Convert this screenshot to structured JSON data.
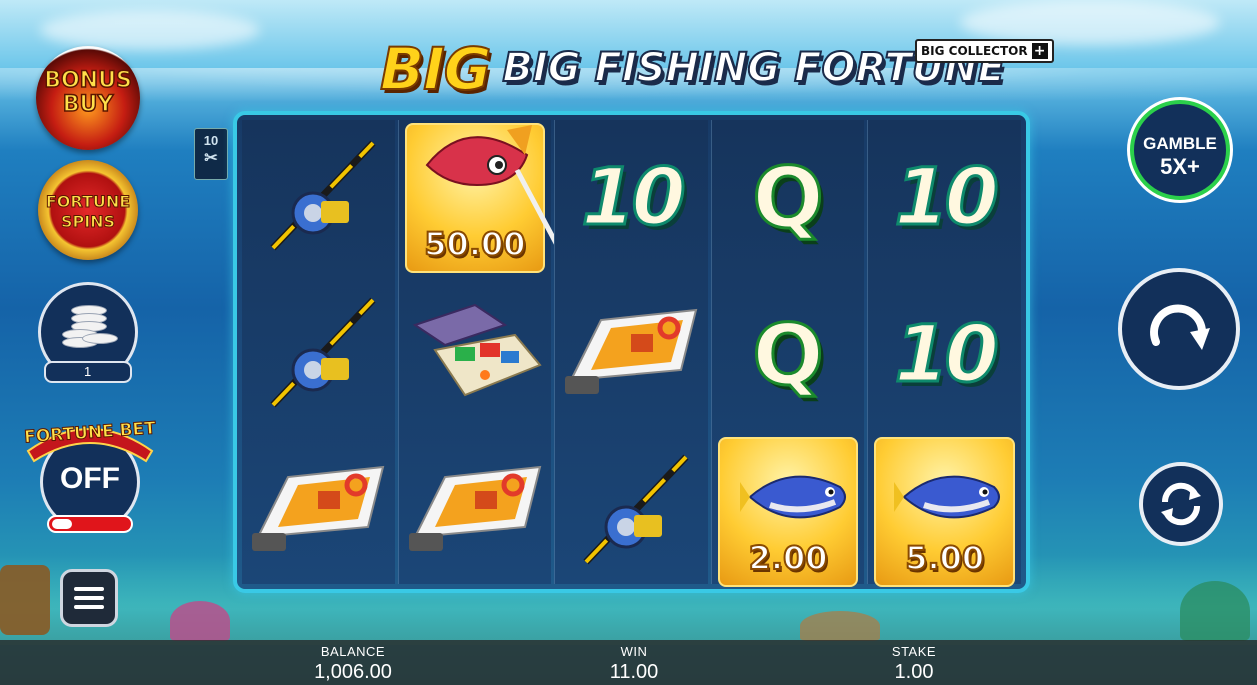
{
  "title": {
    "big": "BIG",
    "rest": "BIG FISHING FORTUNE",
    "collector": "BIG COLLECTOR",
    "collector_plus": "+"
  },
  "left": {
    "bonus_buy_line1": "BONUS",
    "bonus_buy_line2": "BUY",
    "fortune_spins_line1": "FORTUNE",
    "fortune_spins_line2": "SPINS",
    "coin_count": "1",
    "fortune_bet_label": "FORTUNE BET",
    "fortune_bet_state": "OFF",
    "ways_top": "10"
  },
  "reels": [
    [
      "fishing-rod",
      {
        "symbol": "marlin",
        "cash": "50.00"
      },
      "ten"
    ],
    [
      "fishing-rod",
      "tackle-box",
      "boat"
    ],
    [
      "boat",
      "boat",
      "fishing-rod"
    ],
    [
      "ten",
      "Q",
      {
        "symbol": "tuna",
        "cash": "2.00"
      }
    ],
    [
      "ten",
      "ten",
      {
        "symbol": "tuna",
        "cash": "5.00"
      }
    ]
  ],
  "symbols": {
    "ten_text": "10",
    "q_text": "Q",
    "cash_marlin": "50.00",
    "cash_tuna_1": "2.00",
    "cash_tuna_2": "5.00"
  },
  "right": {
    "gamble_line1": "GAMBLE",
    "gamble_line2": "5X+"
  },
  "bottom": {
    "balance_label": "BALANCE",
    "balance_value": "1,006.00",
    "win_label": "WIN",
    "win_value": "11.00",
    "stake_label": "STAKE",
    "stake_value": "1.00"
  },
  "colors": {
    "reel_border": "#39c9e6",
    "gamble_ring": "#2bd04b",
    "off_bar": "#e0151b",
    "title_gold": "#ffd21a"
  }
}
